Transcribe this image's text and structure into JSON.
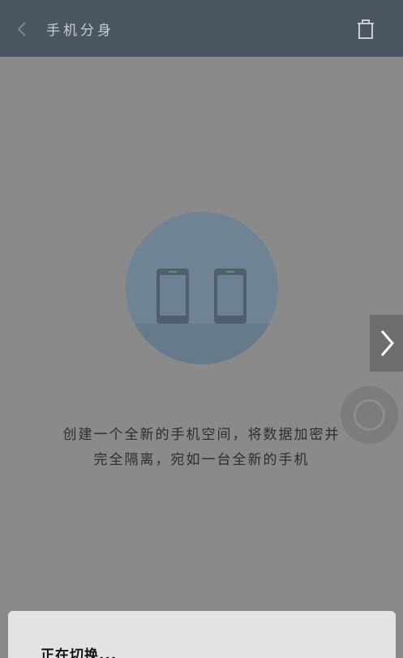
{
  "header": {
    "title": "手机分身"
  },
  "description": {
    "line1": "创建一个全新的手机空间，将数据加密并",
    "line2": "完全隔离，宛如一台全新的手机"
  },
  "sheet": {
    "status_text": "正在切换..."
  },
  "icons": {
    "back": "chevron-left-icon",
    "delete": "trash-icon",
    "next": "chevron-right-icon",
    "illustration": "two-phones-icon"
  },
  "colors": {
    "header_bg": "#4b5662",
    "overlay": "#8a8a8a",
    "illustration_circle": "#6f8394",
    "sheet_bg": "#e3e3e3"
  }
}
